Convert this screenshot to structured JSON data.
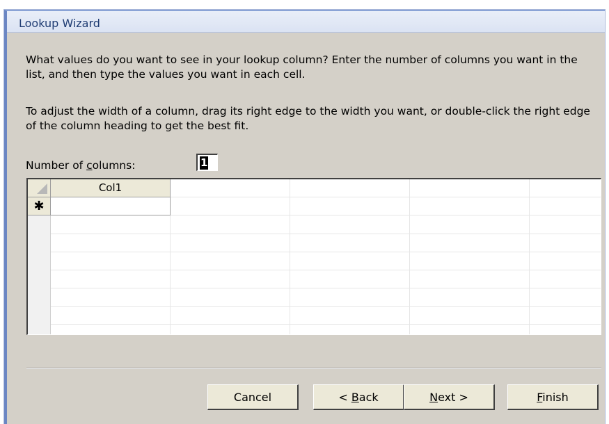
{
  "window": {
    "title": "Lookup Wizard"
  },
  "instructions": {
    "line1": "What values do you want to see in your lookup column? Enter the number of columns you want in the list, and then type the values you want in each cell.",
    "line2": "To adjust the width of a column, drag its right edge to the width you want, or double-click the right edge of the column heading to get the best fit."
  },
  "number_of_columns": {
    "label": "Number of columns:",
    "value": "1"
  },
  "grid": {
    "columns": [
      "Col1"
    ],
    "new_row_symbol": "✱",
    "rows": []
  },
  "buttons": {
    "cancel": "Cancel",
    "back": "< Back",
    "next": "Next >",
    "finish": "Finish"
  },
  "colors": {
    "dialog_bg": "#d4d0c8",
    "title_text": "#1f3c73",
    "frame_border": "#6b86c3"
  }
}
